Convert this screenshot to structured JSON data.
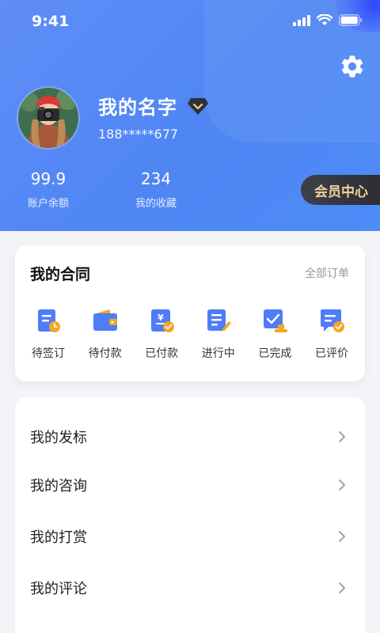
{
  "status_bar": {
    "time": "9:41"
  },
  "profile": {
    "name": "我的名字",
    "phone": "188*****677",
    "stats": [
      {
        "value": "99.9",
        "label": "账户余额"
      },
      {
        "value": "234",
        "label": "我的收藏"
      }
    ],
    "member_center_label": "会员中心"
  },
  "contracts": {
    "title": "我的合同",
    "all_orders_label": "全部订单",
    "items": [
      {
        "label": "待签订",
        "icon": "pending-sign-icon"
      },
      {
        "label": "待付款",
        "icon": "wallet-icon"
      },
      {
        "label": "已付款",
        "icon": "paid-icon"
      },
      {
        "label": "进行中",
        "icon": "in-progress-icon"
      },
      {
        "label": "已完成",
        "icon": "completed-icon"
      },
      {
        "label": "已评价",
        "icon": "reviewed-icon"
      }
    ]
  },
  "menu": {
    "items": [
      {
        "label": "我的发标"
      },
      {
        "label": "我的咨询"
      },
      {
        "label": "我的打赏"
      },
      {
        "label": "我的评论"
      }
    ]
  },
  "colors": {
    "header_gradient_start": "#5f8df6",
    "header_gradient_end": "#4d8bf7",
    "icon_blue": "#4f7cf7",
    "icon_orange": "#f5a623",
    "member_gold": "#f1d39a"
  }
}
